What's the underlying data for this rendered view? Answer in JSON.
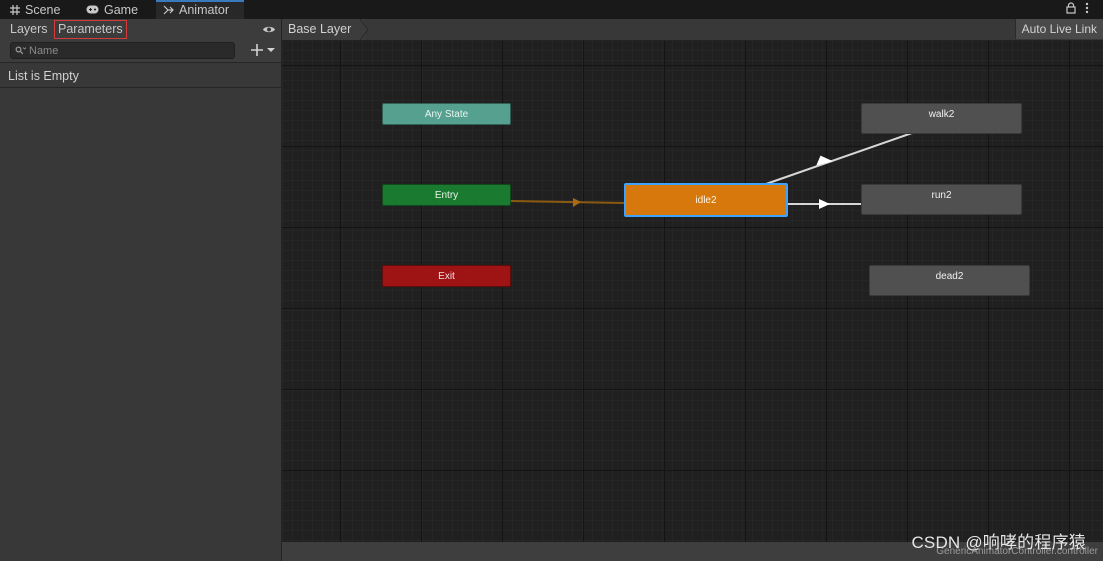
{
  "tabs": [
    {
      "label": "Scene",
      "icon": "grid-icon"
    },
    {
      "label": "Game",
      "icon": "gamepad-icon"
    },
    {
      "label": "Animator",
      "icon": "animator-icon"
    }
  ],
  "active_tab": "Animator",
  "window_icons": [
    "lock-icon",
    "kebab-menu-icon"
  ],
  "left_panel": {
    "tabs": [
      "Layers",
      "Parameters"
    ],
    "active_tab": "Parameters",
    "search": {
      "placeholder": "Name",
      "value": ""
    },
    "empty_message": "List is Empty"
  },
  "graph": {
    "breadcrumb": "Base Layer",
    "live_link_button": "Auto Live Link",
    "states": {
      "any_state": "Any State",
      "entry": "Entry",
      "exit": "Exit",
      "idle": "idle2",
      "walk": "walk2",
      "run": "run2",
      "dead": "dead2"
    },
    "selected_state": "idle2",
    "default_state": "idle2",
    "transitions": [
      {
        "from": "Entry",
        "to": "idle2",
        "kind": "default"
      },
      {
        "from": "idle2",
        "to": "walk2"
      },
      {
        "from": "idle2",
        "to": "run2"
      }
    ],
    "footer_path": "GenericAnimatorController.controller"
  },
  "watermark": "CSDN @响哮的程序猿",
  "colors": {
    "any_state": "#56a08f",
    "entry": "#1a7a2f",
    "exit": "#9e1414",
    "selected_state": "#d6780c",
    "selection_outline": "#3ea2ff",
    "default_state_node": "#505050",
    "highlight_box": "#d63b3b"
  }
}
